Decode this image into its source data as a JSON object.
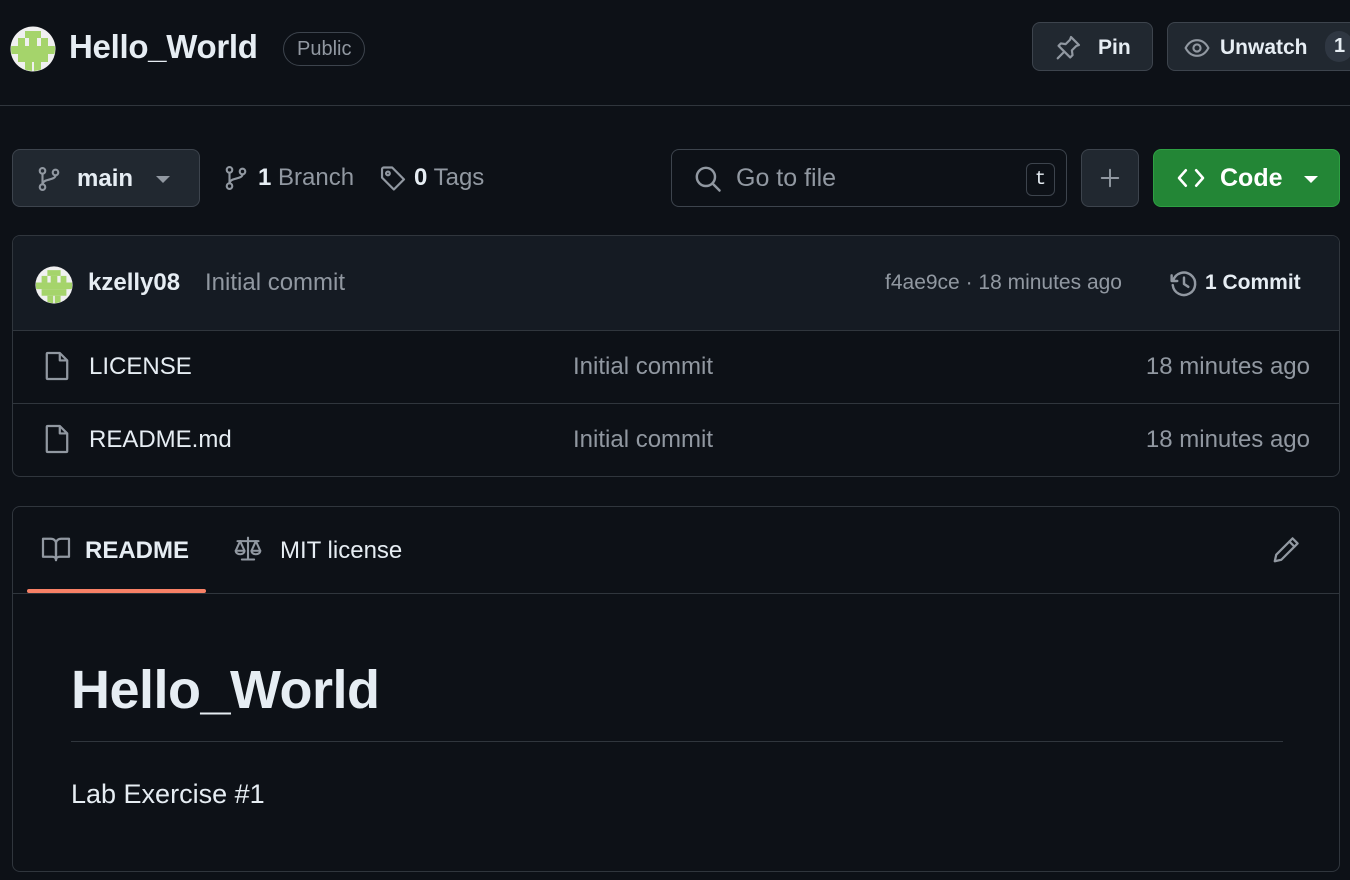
{
  "header": {
    "repo_name": "Hello_World",
    "visibility": "Public",
    "pin_label": "Pin",
    "watch_label": "Unwatch",
    "watch_count": "1"
  },
  "toolbar": {
    "branch_name": "main",
    "branches_count": "1",
    "branches_label": "Branch",
    "tags_count": "0",
    "tags_label": "Tags",
    "search_placeholder": "Go to file",
    "search_shortcut": "t",
    "code_label": "Code"
  },
  "latest_commit": {
    "author": "kzelly08",
    "message": "Initial commit",
    "meta": "f4ae9ce · 18 minutes ago",
    "commits_label": "1 Commit"
  },
  "files": [
    {
      "name": "LICENSE",
      "message": "Initial commit",
      "date": "18 minutes ago",
      "icon": "file-icon"
    },
    {
      "name": "README.md",
      "message": "Initial commit",
      "date": "18 minutes ago",
      "icon": "file-icon"
    }
  ],
  "readme": {
    "tabs": [
      {
        "label": "README",
        "icon": "book-icon",
        "active": true
      },
      {
        "label": "MIT license",
        "icon": "law-scale-icon",
        "active": false
      }
    ],
    "title": "Hello_World",
    "body": "Lab Exercise #1"
  },
  "colors": {
    "background": "#0d1117",
    "border": "#30363d",
    "text_primary": "#e6edf3",
    "text_muted": "#9198a1",
    "code_button": "#238636",
    "active_tab_underline": "#f78166",
    "avatar_green": "#a5d46b"
  }
}
